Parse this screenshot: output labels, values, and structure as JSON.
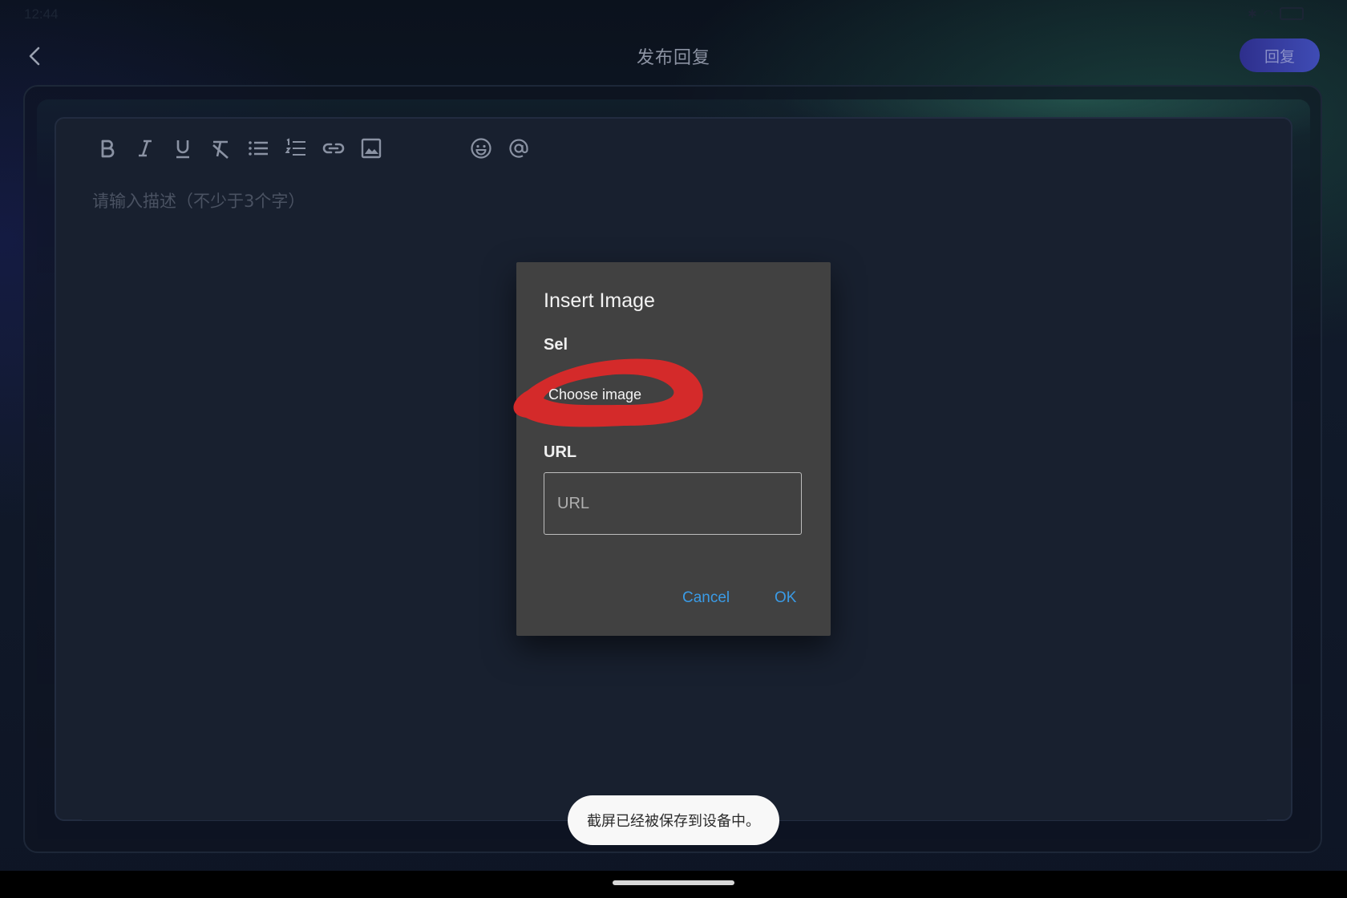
{
  "status_bar": {
    "time": "12:44"
  },
  "header": {
    "title": "发布回复",
    "reply_label": "回复"
  },
  "editor": {
    "placeholder": "请输入描述（不少于3个字）"
  },
  "toolbar": {
    "items": [
      "bold",
      "italic",
      "underline",
      "clear-format",
      "bullet-list",
      "numbered-list",
      "link",
      "image",
      "emoji",
      "mention"
    ]
  },
  "dialog": {
    "title": "Insert Image",
    "select_label": "Sel",
    "choose_image_label": "Choose image",
    "url_label": "URL",
    "url_placeholder": "URL",
    "url_value": "",
    "cancel_label": "Cancel",
    "ok_label": "OK"
  },
  "toast": {
    "message": "截屏已经被保存到设备中。"
  },
  "colors": {
    "accent": "#3a9be6",
    "reply_button": "#3f4cb5",
    "dialog_bg": "#414141",
    "annotation": "#d42a2a"
  }
}
